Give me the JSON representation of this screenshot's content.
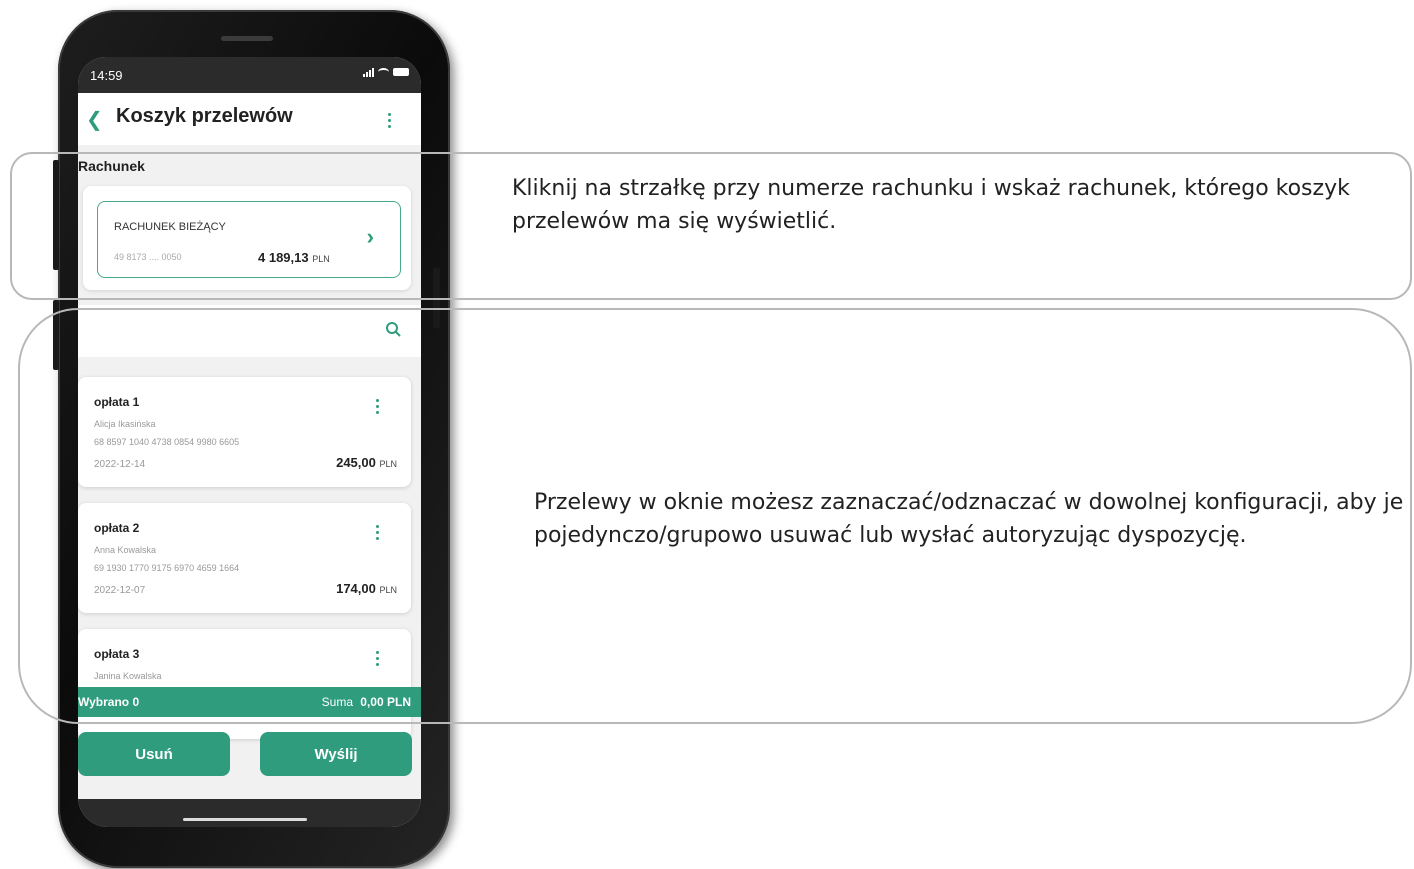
{
  "status_bar": {
    "time": "14:59"
  },
  "header": {
    "title": "Koszyk przelewów"
  },
  "account_section": {
    "label": "Rachunek",
    "account_name": "RACHUNEK BIEŻĄCY",
    "account_number": "49 8173 .... 0050",
    "balance": "4 189,13",
    "currency": "PLN"
  },
  "payments": [
    {
      "title": "opłata 1",
      "payee": "Alicja Ikasińska",
      "account": "68 8597 1040 4738 0854 9980 6605",
      "date": "2022-12-14",
      "amount": "245,00",
      "currency": "PLN"
    },
    {
      "title": "opłata 2",
      "payee": "Anna Kowalska",
      "account": "69 1930 1770 9175 6970 4659 1664",
      "date": "2022-12-07",
      "amount": "174,00",
      "currency": "PLN"
    },
    {
      "title": "opłata 3",
      "payee": "Janina Kowalska"
    }
  ],
  "footer": {
    "selected": "Wybrano 0",
    "sum_label": "Suma",
    "sum_value": "0,00 PLN"
  },
  "actions": {
    "delete_label": "Usuń",
    "send_label": "Wyślij"
  },
  "callouts": {
    "text_1": "Kliknij na strzałkę przy numerze rachunku i wskaż rachunek, którego koszyk przelewów ma się wyświetlić.",
    "text_2": "Przelewy w oknie możesz zaznaczać/odznaczać w dowolnej konfiguracji, aby je pojedynczo/grupowo usuwać lub wysłać autoryzując dyspozycję."
  },
  "colors": {
    "accent": "#2e9c7d",
    "callout_border": "#b8b8b8"
  }
}
